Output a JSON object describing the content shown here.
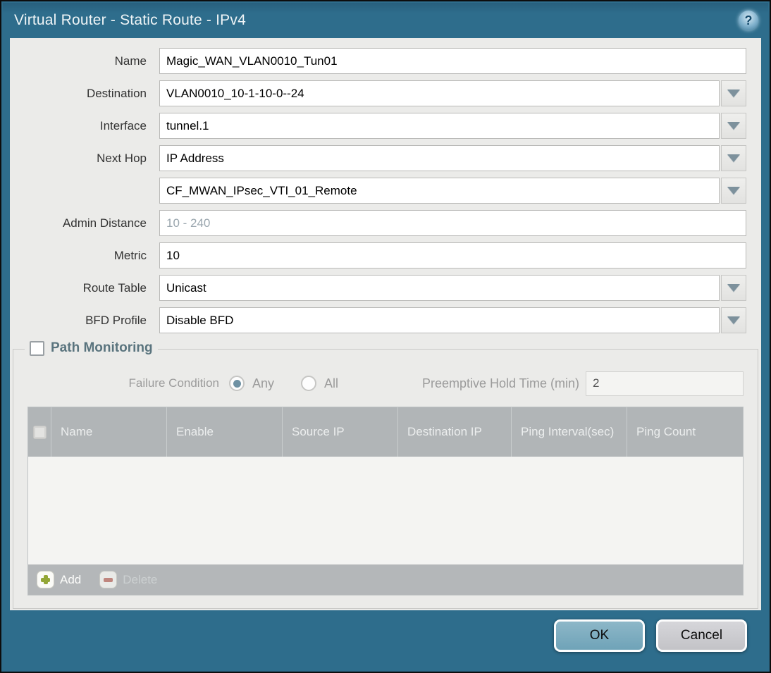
{
  "dialog": {
    "title": "Virtual Router - Static Route - IPv4"
  },
  "icons": {
    "help": "?"
  },
  "form": {
    "name": {
      "label": "Name",
      "value": "Magic_WAN_VLAN0010_Tun01"
    },
    "destination": {
      "label": "Destination",
      "value": "VLAN0010_10-1-10-0--24"
    },
    "interface": {
      "label": "Interface",
      "value": "tunnel.1"
    },
    "next_hop": {
      "label": "Next Hop",
      "value": "IP Address"
    },
    "next_hop_address": {
      "value": "CF_MWAN_IPsec_VTI_01_Remote"
    },
    "admin_distance": {
      "label": "Admin Distance",
      "value": "",
      "placeholder": "10 - 240"
    },
    "metric": {
      "label": "Metric",
      "value": "10"
    },
    "route_table": {
      "label": "Route Table",
      "value": "Unicast"
    },
    "bfd_profile": {
      "label": "BFD Profile",
      "value": "Disable BFD"
    }
  },
  "path_monitoring": {
    "title": "Path Monitoring",
    "enabled": false,
    "failure_condition": {
      "label": "Failure Condition",
      "options": [
        {
          "label": "Any",
          "selected": true
        },
        {
          "label": "All",
          "selected": false
        }
      ]
    },
    "preemptive_hold_time": {
      "label": "Preemptive Hold Time (min)",
      "value": "2"
    },
    "table": {
      "columns": [
        "Name",
        "Enable",
        "Source IP",
        "Destination IP",
        "Ping Interval(sec)",
        "Ping Count"
      ],
      "rows": [],
      "add_label": "Add",
      "delete_label": "Delete"
    }
  },
  "footer": {
    "ok_label": "OK",
    "cancel_label": "Cancel"
  },
  "colors": {
    "accent": "#2e6d8c",
    "content_bg": "#ebebe9",
    "table_header_bg": "#b1b5b7",
    "ok_button_bg": "#6fa3b8",
    "add_icon_green": "#93a636",
    "delete_icon_red": "#c3766b"
  }
}
